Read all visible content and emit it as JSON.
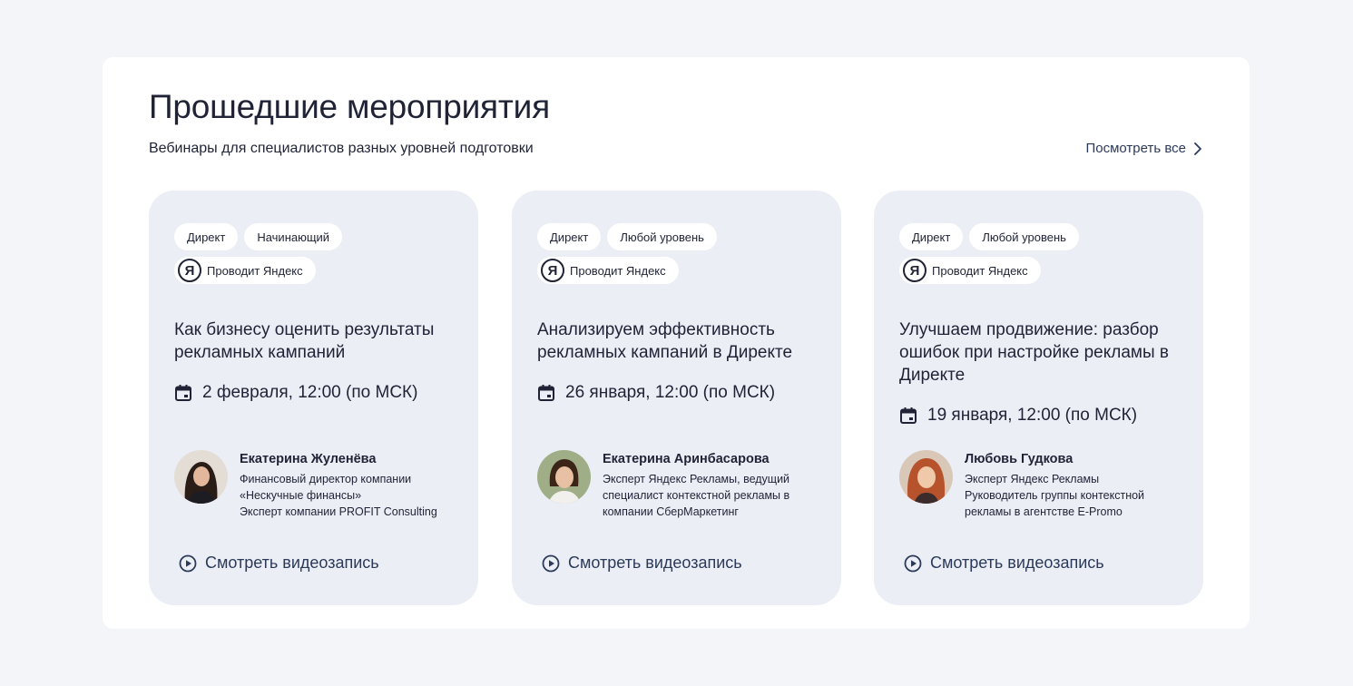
{
  "section": {
    "title": "Прошедшие мероприятия",
    "subtitle": "Вебинары для специалистов разных уровней подготовки",
    "see_all_label": "Посмотреть все"
  },
  "colors": {
    "page_bg": "#f4f5f9",
    "panel_bg": "#ffffff",
    "card_bg": "#ebeef5",
    "text": "#1f2335",
    "link": "#2c3a5a"
  },
  "events": [
    {
      "tags": [
        "Директ",
        "Начинающий"
      ],
      "host_label": "Проводит Яндекс",
      "host_logo": "Я",
      "title": "Как бизнесу оценить результаты рекламных кампаний",
      "date": "2 февраля, 12:00 (по МСК)",
      "speaker": {
        "name": "Екатерина Жуленёва",
        "desc_lines": [
          "Финансовый директор компании",
          "«Нескучные финансы»",
          "Эксперт компании PROFIT Consulting"
        ]
      },
      "watch_label": "Смотреть видеозапись"
    },
    {
      "tags": [
        "Директ",
        "Любой уровень"
      ],
      "host_label": "Проводит Яндекс",
      "host_logo": "Я",
      "title": "Анализируем эффективность рекламных кампаний в Директе",
      "date": "26 января, 12:00 (по МСК)",
      "speaker": {
        "name": "Екатерина Аринбасарова",
        "desc_lines": [
          "Эксперт Яндекс Рекламы, ведущий",
          "специалист контекстной рекламы в",
          "компании СберМаркетинг"
        ]
      },
      "watch_label": "Смотреть видеозапись"
    },
    {
      "tags": [
        "Директ",
        "Любой уровень"
      ],
      "host_label": "Проводит Яндекс",
      "host_logo": "Я",
      "title": "Улучшаем продвижение: разбор ошибок при настройке рекламы в Директе",
      "date": "19 января, 12:00 (по МСК)",
      "speaker": {
        "name": "Любовь Гудкова",
        "desc_lines": [
          "Эксперт Яндекс Рекламы",
          "Руководитель группы контекстной",
          "рекламы в агентстве E-Promo"
        ]
      },
      "watch_label": "Смотреть видеозапись"
    }
  ]
}
